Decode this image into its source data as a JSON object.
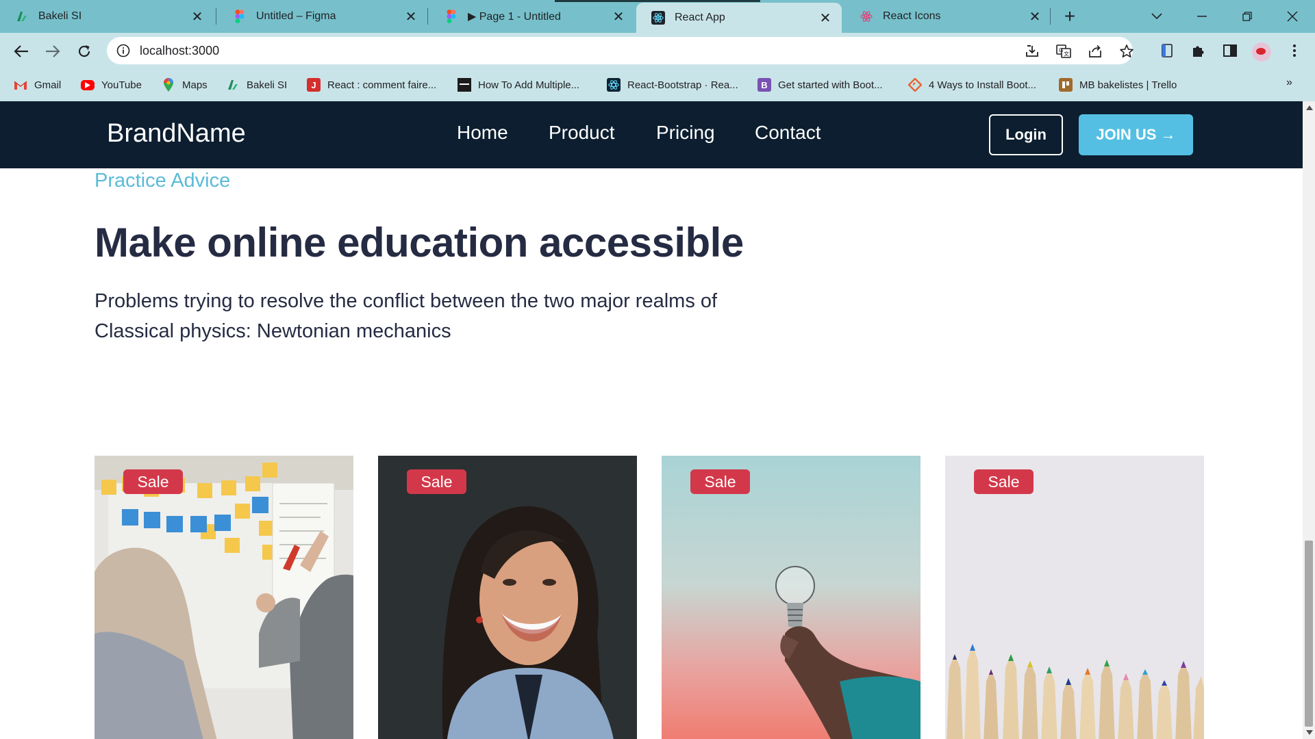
{
  "browser": {
    "tabs": [
      {
        "title": "Bakeli SI",
        "icon": "bakeli-icon"
      },
      {
        "title": "Untitled – Figma",
        "icon": "figma-icon"
      },
      {
        "title": "▶ Page 1 - Untitled",
        "icon": "figma-icon"
      },
      {
        "title": "React App",
        "icon": "react-icon",
        "active": true
      },
      {
        "title": "React Icons",
        "icon": "react-icon"
      }
    ],
    "url": "localhost:3000",
    "bookmarks": [
      {
        "label": "Gmail",
        "icon": "gmail-icon"
      },
      {
        "label": "YouTube",
        "icon": "youtube-icon"
      },
      {
        "label": "Maps",
        "icon": "maps-icon"
      },
      {
        "label": "Bakeli SI",
        "icon": "bakeli-icon"
      },
      {
        "label": "React : comment faire...",
        "icon": "j-icon"
      },
      {
        "label": "How To Add Multiple...",
        "icon": "page-icon"
      },
      {
        "label": "React-Bootstrap · Rea...",
        "icon": "react-bootstrap-icon"
      },
      {
        "label": "Get started with Boot...",
        "icon": "bootstrap-icon"
      },
      {
        "label": "4 Ways to Install Boot...",
        "icon": "diamond-icon"
      },
      {
        "label": "MB bakelistes | Trello",
        "icon": "trello-icon"
      }
    ],
    "bookmarks_more": "»"
  },
  "site": {
    "brand": "BrandName",
    "nav": [
      "Home",
      "Product",
      "Pricing",
      "Contact"
    ],
    "login_label": "Login",
    "join_label": "JOIN US →"
  },
  "hero": {
    "eyebrow": "Practice Advice",
    "headline": "Make online education accessible",
    "lead": "Problems trying to resolve the conflict between the two major realms of Classical physics: Newtonian mechanics"
  },
  "cards": [
    {
      "badge": "Sale",
      "image": "team-sticky-notes-photo"
    },
    {
      "badge": "Sale",
      "image": "smiling-woman-photo"
    },
    {
      "badge": "Sale",
      "image": "hand-holding-lightbulb-photo"
    },
    {
      "badge": "Sale",
      "image": "colored-pencils-photo"
    }
  ],
  "colors": {
    "tabstrip": "#77c0cb",
    "toolbar": "#c9e4e8",
    "site_nav": "#0c1e2f",
    "accent": "#55bfe3",
    "eyebrow": "#5bbbd7",
    "heading": "#252b42",
    "sale_badge": "#d3384a"
  }
}
